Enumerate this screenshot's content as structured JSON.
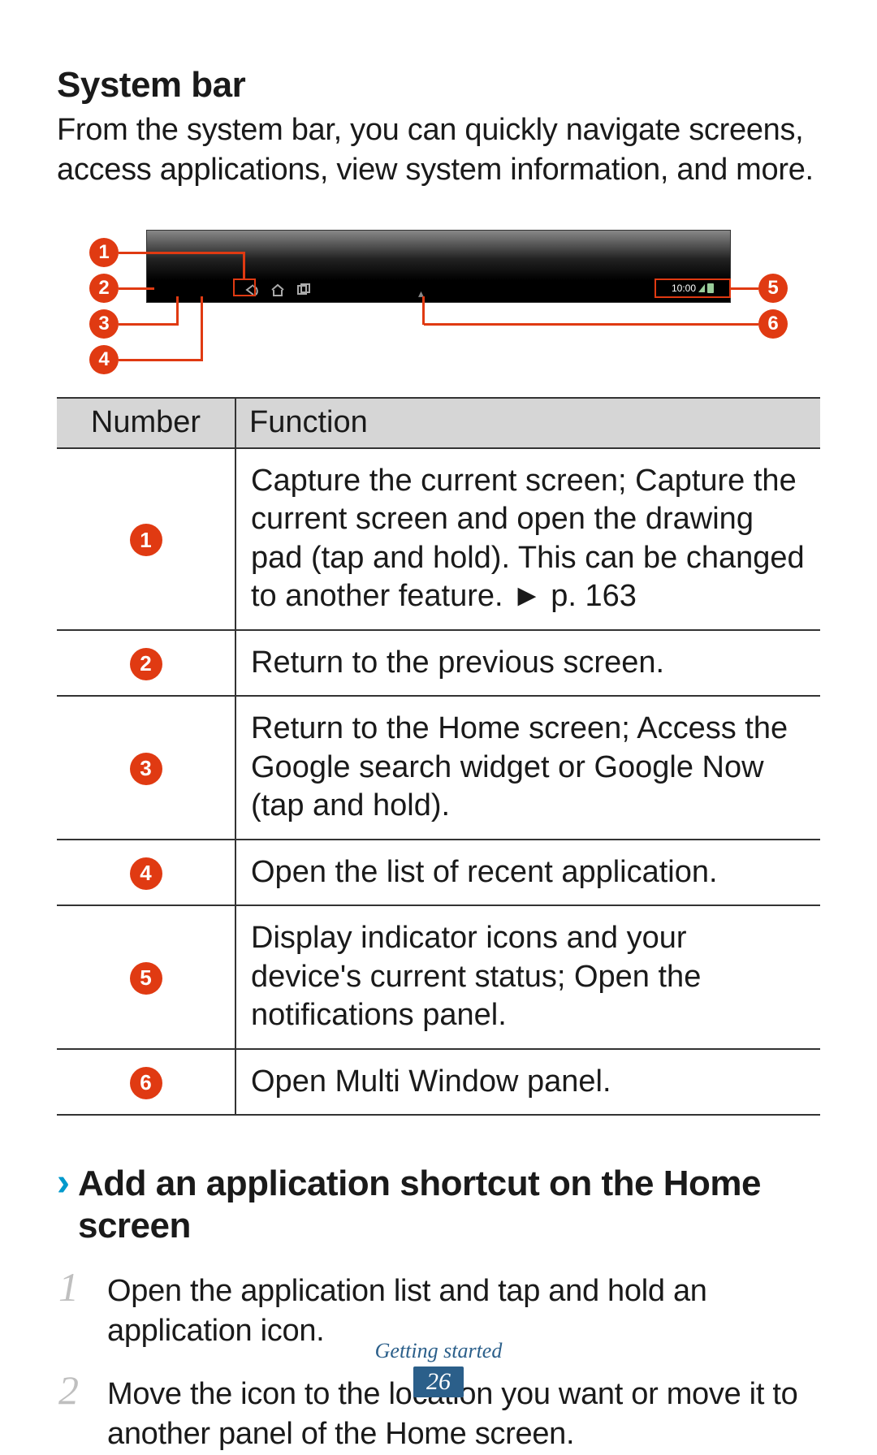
{
  "heading": "System bar",
  "intro": "From the system bar, you can quickly navigate screens, access applications, view system information, and more.",
  "diagram": {
    "status_time": "10:00",
    "callouts": [
      "1",
      "2",
      "3",
      "4",
      "5",
      "6"
    ]
  },
  "table": {
    "header_number": "Number",
    "header_function": "Function",
    "rows": [
      {
        "n": "1",
        "text": "Capture the current screen; Capture the current screen and open the drawing pad (tap and hold). This can be changed to another feature. ► p. 163"
      },
      {
        "n": "2",
        "text": "Return to the previous screen."
      },
      {
        "n": "3",
        "text": "Return to the Home screen; Access the Google search widget or Google Now (tap and hold)."
      },
      {
        "n": "4",
        "text": "Open the list of recent application."
      },
      {
        "n": "5",
        "text": "Display indicator icons and your device's current status; Open the notifications panel."
      },
      {
        "n": "6",
        "text": "Open Multi Window panel."
      }
    ]
  },
  "subsection": {
    "chevron": "›",
    "title": "Add an application shortcut on the Home screen",
    "steps": [
      {
        "n": "1",
        "text": "Open the application list and tap and hold an application icon."
      },
      {
        "n": "2",
        "text": "Move the icon to the location you want or move it to another panel of the Home screen."
      }
    ]
  },
  "footer": {
    "section": "Getting started",
    "page": "26"
  }
}
